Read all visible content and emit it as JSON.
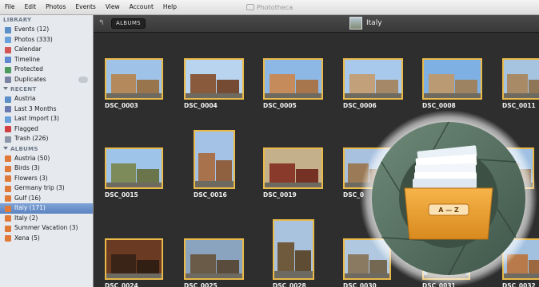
{
  "app_title": "Phototheca",
  "menu": [
    "File",
    "Edit",
    "Photos",
    "Events",
    "View",
    "Account",
    "Help"
  ],
  "sidebar": {
    "library": {
      "heading": "LIBRARY",
      "items": [
        {
          "label": "Events (12)",
          "icon": "events-icon",
          "color": "#5a8fc8"
        },
        {
          "label": "Photos (333)",
          "icon": "photos-icon",
          "color": "#6aa0d8"
        },
        {
          "label": "Calendar",
          "icon": "calendar-icon",
          "color": "#d25656"
        },
        {
          "label": "Timeline",
          "icon": "timeline-icon",
          "color": "#5e8ad0"
        },
        {
          "label": "Protected",
          "icon": "lock-icon",
          "color": "#4e9a5e"
        },
        {
          "label": "Duplicates",
          "icon": "duplicates-icon",
          "color": "#7b84a2"
        }
      ]
    },
    "recent": {
      "heading": "RECENT",
      "items": [
        {
          "label": "Austria",
          "icon": "austria-album-icon",
          "color": "#5a8fc8"
        },
        {
          "label": "Last 3 Months",
          "icon": "clock-icon",
          "color": "#6b7bb0"
        },
        {
          "label": "Last Import (3)",
          "icon": "import-icon",
          "color": "#6aa0d8"
        },
        {
          "label": "Flagged",
          "icon": "flag-icon",
          "color": "#d04242"
        },
        {
          "label": "Trash (226)",
          "icon": "trash-icon",
          "color": "#8d96a6"
        }
      ]
    },
    "albums": {
      "heading": "ALBUMS",
      "items": [
        {
          "label": "Austria (50)",
          "icon": "album-icon",
          "color": "#e07a3a"
        },
        {
          "label": "Birds (3)",
          "icon": "album-icon",
          "color": "#e07a3a"
        },
        {
          "label": "Flowers (3)",
          "icon": "album-icon",
          "color": "#e07a3a"
        },
        {
          "label": "Germany trip (3)",
          "icon": "album-icon",
          "color": "#e07a3a"
        },
        {
          "label": "Gulf (16)",
          "icon": "album-icon",
          "color": "#e07a3a"
        },
        {
          "label": "Italy (171)",
          "icon": "album-icon",
          "color": "#e07a3a",
          "selected": true
        },
        {
          "label": "Italy (2)",
          "icon": "album-icon",
          "color": "#e07a3a"
        },
        {
          "label": "Summer Vacation (3)",
          "icon": "album-icon",
          "color": "#e07a3a"
        },
        {
          "label": "Xena (5)",
          "icon": "album-icon",
          "color": "#e07a3a"
        }
      ]
    }
  },
  "toolbar": {
    "albums_label": "ALBUMS",
    "current_album": "Italy"
  },
  "photos": [
    {
      "name": "DSC_0003",
      "sky": "#9fc3e8",
      "bld": "#b48a5c"
    },
    {
      "name": "DSC_0004",
      "sky": "#b8d4ef",
      "bld": "#8a5a3c"
    },
    {
      "name": "DSC_0005",
      "sky": "#8db8e6",
      "bld": "#c58b5a"
    },
    {
      "name": "DSC_0006",
      "sky": "#a9c9ec",
      "bld": "#c2a07a"
    },
    {
      "name": "DSC_0008",
      "sky": "#7fb0e3",
      "bld": "#b99a72"
    },
    {
      "name": "DSC_0011",
      "sky": "#a6c4e0",
      "bld": "#a88b66"
    },
    {
      "name": "DSC_0015",
      "sky": "#9fc4ea",
      "bld": "#7d8a5a"
    },
    {
      "name": "DSC_0016",
      "sky": "#a4c2e6",
      "bld": "#a8724c"
    },
    {
      "name": "DSC_0019",
      "sky": "#c4b08a",
      "bld": "#8a3a2a"
    },
    {
      "name": "DSC_0",
      "sky": "#a7c1df",
      "bld": "#9b7a58"
    },
    {
      "name": "DSC_0024",
      "sky": "#6b3a22",
      "bld": "#3a2418"
    },
    {
      "name": "DSC_0025",
      "sky": "#8aa4c0",
      "bld": "#6a5a48"
    },
    {
      "name": "DSC_0028",
      "sky": "#a9c3df",
      "bld": "#6f5a3e"
    },
    {
      "name": "DSC_0030",
      "sky": "#b0c8e0",
      "bld": "#8a7a62"
    },
    {
      "name": "DSC_0031",
      "sky": "#9eb8d4",
      "bld": "#7a6a50"
    },
    {
      "name": "DSC_0032",
      "sky": "#a2c0e0",
      "bld": "#b87a4a"
    },
    {
      "name": "DSC_0",
      "sky": "#9fc0e2",
      "bld": "#9a7a5a"
    }
  ],
  "overlay": {
    "tab_label": "A — Z"
  }
}
